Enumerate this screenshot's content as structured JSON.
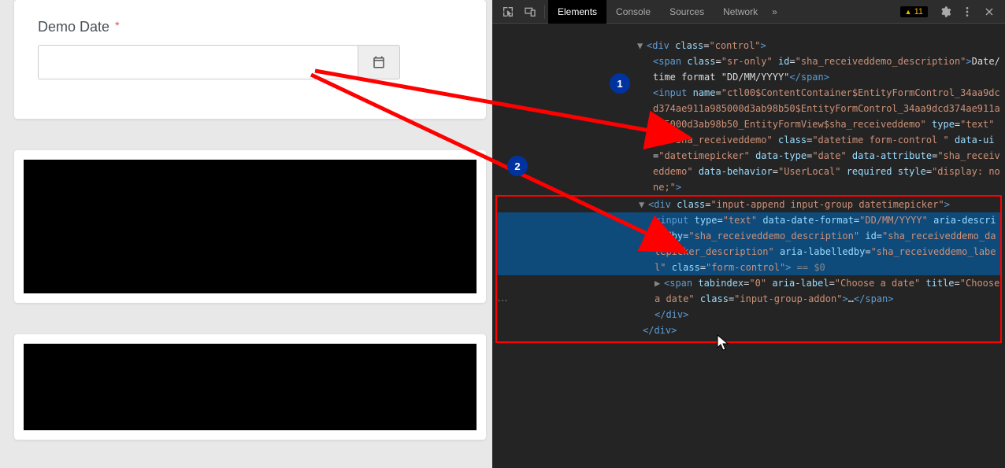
{
  "form": {
    "label": "Demo Date",
    "required_marker": "*",
    "input_value": "",
    "addon_title": "Choose a date"
  },
  "devtools": {
    "tabs": [
      "Elements",
      "Console",
      "Sources",
      "Network"
    ],
    "active_tab": "Elements",
    "more_glyph": "»",
    "warning_count": "11"
  },
  "dom": {
    "l1_open": "<div class=\"control\">",
    "span_open": "<span class=\"sr-only\" id=\"sha_receiveddemo_description\">",
    "span_text": "Date/time format \"DD/MM/YYYY\"",
    "span_close": "</span>",
    "input1": "<input name=\"ctl00$ContentContainer$EntityFormControl_34aa9dcd374ae911a985000d3ab98b50$EntityFormControl_34aa9dcd374ae911a985000d3ab98b50_EntityFormView$sha_receiveddemo\" type=\"text\" id=\"sha_receiveddemo\" class=\"datetime form-control \" data-ui=\"datetimepicker\" data-type=\"date\" data-attribute=\"sha_receiveddemo\" data-behavior=\"UserLocal\" required style=\"display: none;\">",
    "div2_open": "<div class=\"input-append input-group datetimepicker\">",
    "input2": "<input type=\"text\" data-date-format=\"DD/MM/YYYY\" aria-describedby=\"sha_receiveddemo_description\" id=\"sha_receiveddemo_datepicker_description\" aria-labelledby=\"sha_receiveddemo_label\" class=\"form-control\">",
    "eq0": " == $0",
    "span2": "<span tabindex=\"0\" aria-label=\"Choose a date\" title=\"Choose a date\" class=\"input-group-addon\">…</span>",
    "div2_close": "</div>",
    "div1_close": "</div>"
  },
  "badges": {
    "b1": "1",
    "b2": "2"
  },
  "ellipsis": "…"
}
